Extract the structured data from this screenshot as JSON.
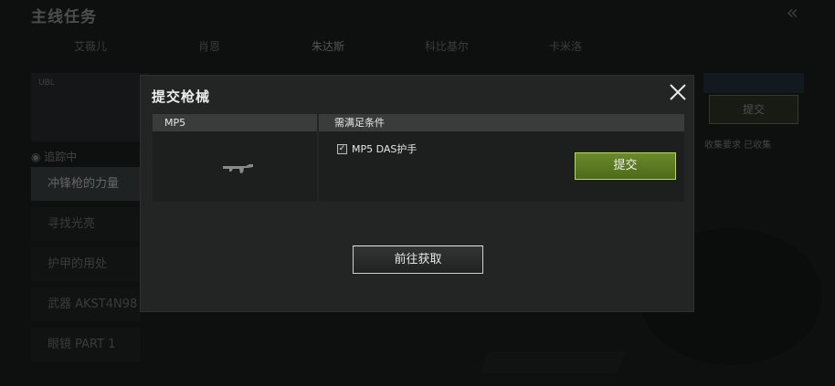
{
  "background": {
    "title": "主线任务",
    "back_icon": "double-chevron-left-icon",
    "tabs": [
      "艾薇儿",
      "肖恩",
      "朱达斯",
      "科比基尔",
      "卡米洛"
    ],
    "active_tab": 2,
    "card_label": "UBL",
    "tracking_label": "追踪中",
    "quests": [
      "冲锋枪的力量",
      "寻找光亮",
      "护甲的用处",
      "武器 AKST4N98",
      "眼镜 PART 1"
    ],
    "right_submit_label": "提交",
    "right_note": "收集要求 已收集"
  },
  "modal": {
    "title": "提交枪械",
    "close_icon": "close-icon",
    "weapon_name": "MP5",
    "weapon_icon": "smg-icon",
    "requirements_header": "需满足条件",
    "requirements": [
      {
        "label": "MP5 DAS护手",
        "checked": true
      }
    ],
    "submit_label": "提交",
    "goto_label": "前往获取"
  },
  "colors": {
    "accent_green": "#6a8a2a",
    "accent_green_border": "#b6e04a",
    "panel": "#1d1f1f",
    "header": "#3a3c3c"
  }
}
